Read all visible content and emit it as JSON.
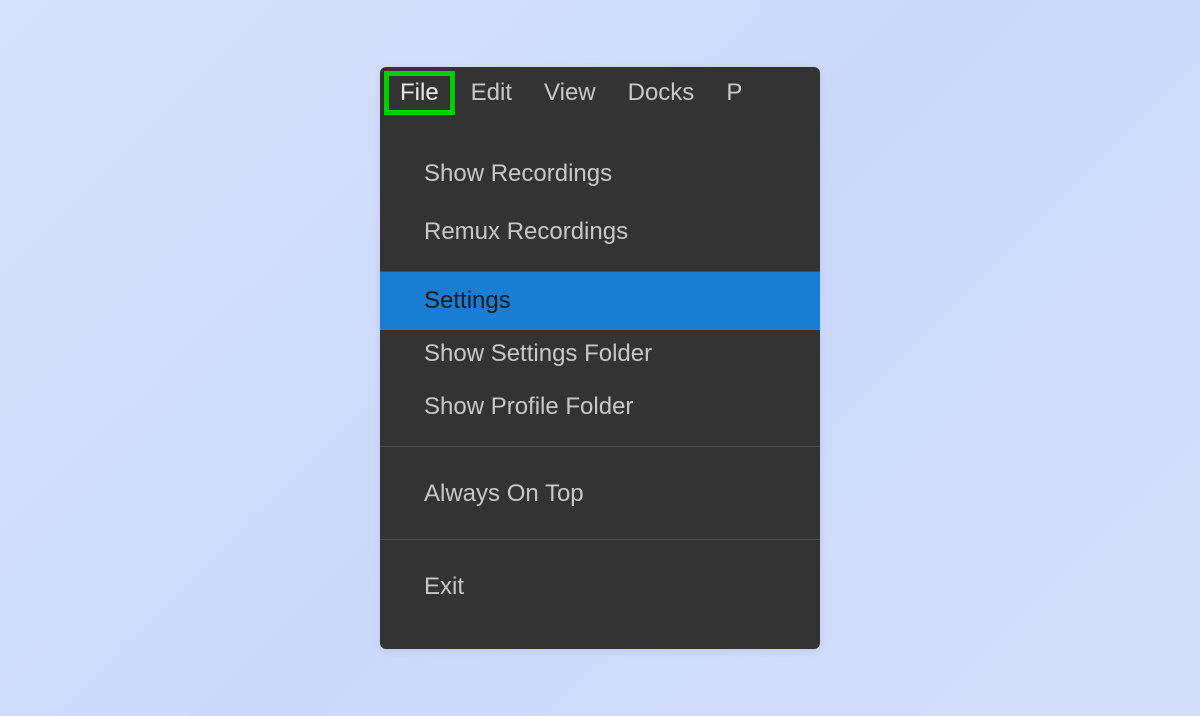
{
  "menubar": {
    "file": "File",
    "edit": "Edit",
    "view": "View",
    "docks": "Docks",
    "partial": "P"
  },
  "fileMenu": {
    "showRecordings": "Show Recordings",
    "remuxRecordings": "Remux Recordings",
    "settings": "Settings",
    "showSettingsFolder": "Show Settings Folder",
    "showProfileFolder": "Show Profile Folder",
    "alwaysOnTop": "Always On Top",
    "exit": "Exit"
  },
  "colors": {
    "highlight": "#00d000",
    "selection": "#1a7dd4",
    "menuBg": "#333333"
  }
}
